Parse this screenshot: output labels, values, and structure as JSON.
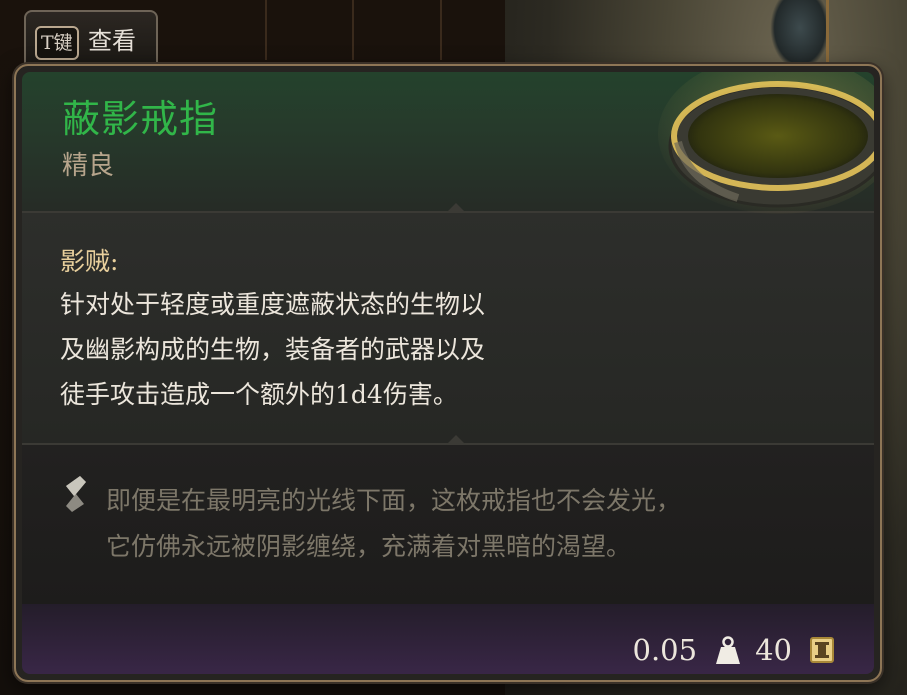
{
  "view_button": {
    "key": "T键",
    "label": "查看"
  },
  "item": {
    "name": "蔽影戒指",
    "rarity": "精良",
    "name_color": "#31b649"
  },
  "effect": {
    "title": "影贼:",
    "description_lines": [
      "针对处于轻度或重度遮蔽状态的生物以",
      "及幽影构成的生物，装备者的武器以及",
      "徒手攻击造成一个额外的1d4伤害。"
    ]
  },
  "lore": {
    "lines": [
      "即便是在最明亮的光线下面，这枚戒指也不会发光，",
      "它仿佛永远被阴影缠绕，充满着对黑暗的渴望。"
    ]
  },
  "stats": {
    "weight": "0.05",
    "weight_icon": "weight-icon",
    "value": "40",
    "value_icon": "gold-coin-icon"
  }
}
